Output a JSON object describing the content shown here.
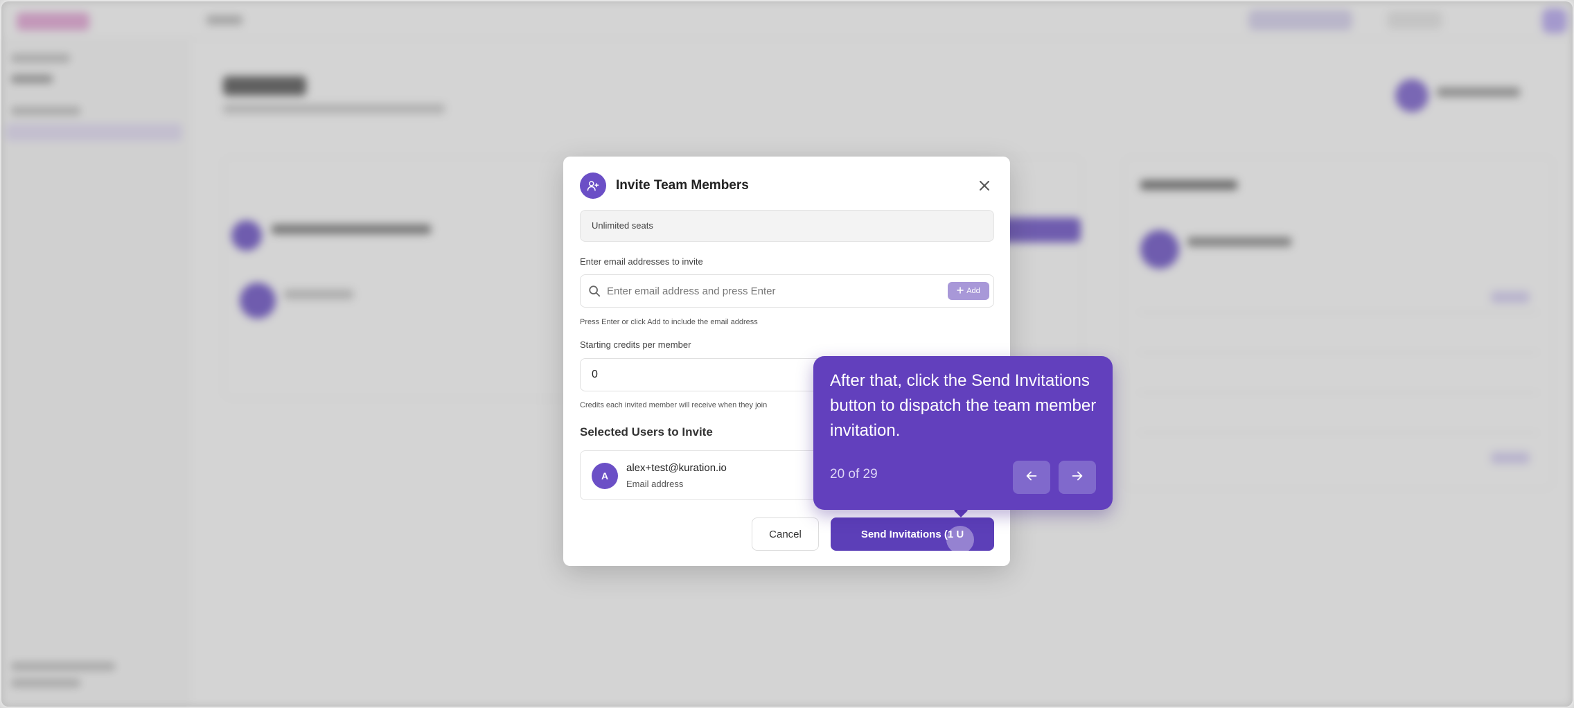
{
  "modal": {
    "title": "Invite Team Members",
    "seats_text": "Unlimited seats",
    "email_label": "Enter email addresses to invite",
    "email_placeholder": "Enter email address and press Enter",
    "add_label": "Add",
    "email_hint": "Press Enter or click Add to include the email address",
    "credits_label": "Starting credits per member",
    "credits_value": "0",
    "credits_hint": "Credits each invited member will receive when they join",
    "selected_title": "Selected Users to Invite",
    "selected_users": [
      {
        "initial": "A",
        "email": "alex+test@kuration.io",
        "type": "Email address"
      }
    ],
    "cancel_label": "Cancel",
    "send_label": "Send Invitations (1 U"
  },
  "tour": {
    "text": "After that, click the Send Invitations button to dispatch the team member invitation.",
    "counter": "20 of 29"
  },
  "icons": {
    "modal": "user-plus-icon",
    "close": "close-icon",
    "search": "search-icon",
    "add": "plus-icon",
    "prev": "arrow-left-icon",
    "next": "arrow-right-icon"
  },
  "colors": {
    "accent": "#5c3fb8",
    "tooltip": "#6240bd",
    "avatar": "#6b4fc6"
  }
}
